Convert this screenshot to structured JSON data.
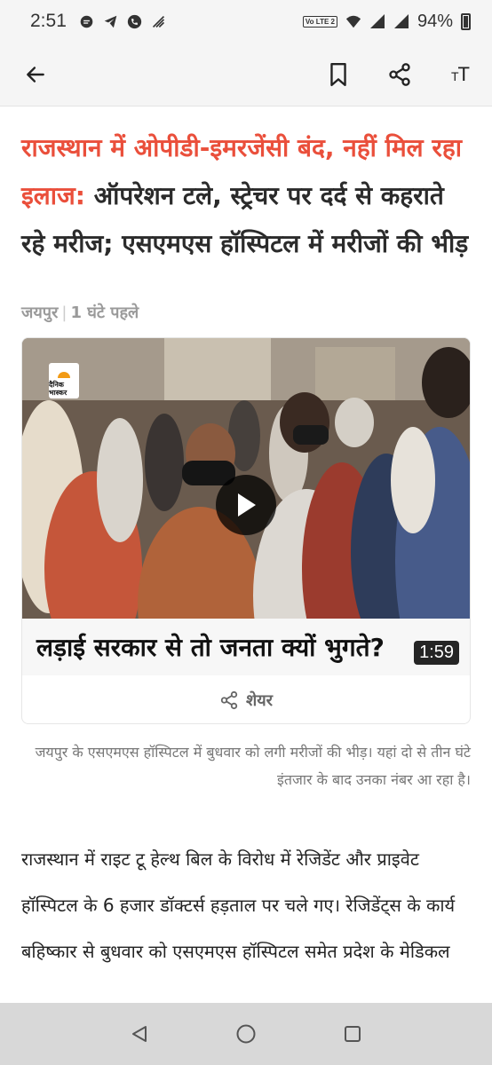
{
  "status_bar": {
    "time": "2:51",
    "volte_label": "Vo LTE 2",
    "battery": "94%",
    "icons_left": [
      "message-icon",
      "telegram-icon",
      "phone-icon",
      "signal-stripes-icon"
    ],
    "icons_right": [
      "volte-icon",
      "wifi-icon",
      "cell-signal-icon",
      "cell-signal-icon",
      "battery-icon"
    ]
  },
  "app_bar": {
    "icons": [
      "back-arrow-icon",
      "bookmark-icon",
      "share-icon",
      "font-size-icon"
    ],
    "font_size_label": "TT"
  },
  "article": {
    "headline_highlight": "राजस्थान में ओपीडी-इमरजेंसी बंद, नहीं मिल रहा इलाज:",
    "headline_rest": " ऑपरेशन टले, स्ट्रेचर पर दर्द से कहराते रहे मरीज; एसएमएस हॉस्पिटल में मरीजों की भीड़",
    "location": "जयपुर",
    "time_ago": "1 घंटे पहले",
    "video": {
      "logo_text": "दैनिक भास्कर",
      "caption": "लड़ाई सरकार से तो जनता क्यों भुगते?",
      "duration": "1:59",
      "share_label": "शेयर"
    },
    "photo_caption": "जयपुर के एसएमएस हॉस्पिटल में बुधवार को लगी मरीजों की भीड़। यहां दो से तीन घंटे इंतजार के बाद उनका नंबर आ रहा है।",
    "body": "राजस्थान में राइट टू हेल्थ बिल के विरोध में रेजिडेंट और प्राइवेट हॉस्पिटल के 6 हजार डॉक्टर्स हड़ताल पर चले गए। रेजिडेंट्स के कार्य बहिष्कार से बुधवार को एसएमएस हॉस्पिटल समेत प्रदेश के मेडिकल"
  },
  "nav_bar": {
    "icons": [
      "back-triangle-icon",
      "home-circle-icon",
      "recents-square-icon"
    ]
  },
  "colors": {
    "accent_red": "#ea4f3b",
    "text": "#2b2b2b",
    "muted": "#9a9a9a",
    "bar_bg": "#f5f5f5",
    "nav_bg": "#d8d8d8"
  }
}
